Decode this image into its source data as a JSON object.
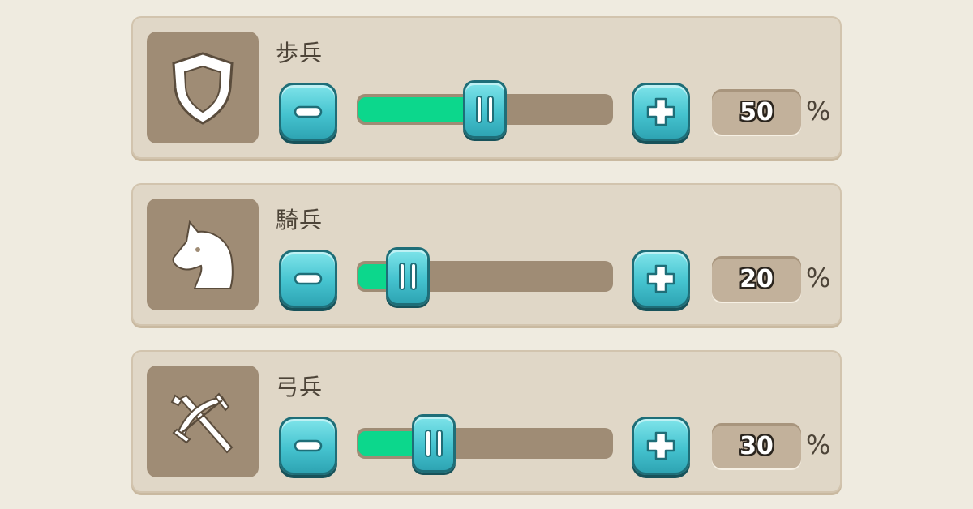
{
  "units": [
    {
      "name": "歩兵",
      "icon": "shield-icon",
      "value": "50",
      "percent": 50,
      "unit": "%"
    },
    {
      "name": "騎兵",
      "icon": "horse-head-icon",
      "value": "20",
      "percent": 20,
      "unit": "%"
    },
    {
      "name": "弓兵",
      "icon": "crossbow-icon",
      "value": "30",
      "percent": 30,
      "unit": "%"
    }
  ],
  "colors": {
    "fill": "#0cd78c",
    "button": "#45c3cf",
    "track": "#9f8c75",
    "panel": "#e0d7c7"
  }
}
